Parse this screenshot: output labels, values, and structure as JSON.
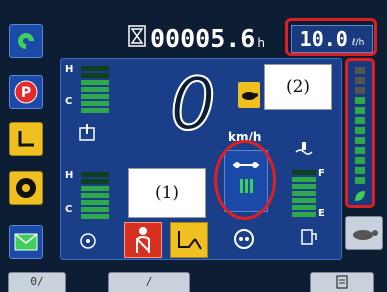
{
  "header": {
    "hourmeter_value": "00005.6",
    "hourmeter_unit": "h",
    "fuel_rate_value": "10.0",
    "fuel_rate_unit": "ℓ/h"
  },
  "speed": {
    "value": "0",
    "unit": "km/h"
  },
  "callouts": {
    "callout_1": "(1)",
    "callout_2": "(2)"
  },
  "gauges": {
    "temp_gauge_1": {
      "high_label": "H",
      "low_label": "C"
    },
    "temp_gauge_2": {
      "high_label": "H",
      "low_label": "C"
    },
    "fuel_gauge": {
      "full_label": "F",
      "empty_label": "E"
    }
  },
  "bottom_bar": {
    "tab_1": "0/",
    "tab_2": "/",
    "tab_3": ""
  },
  "colors": {
    "panel_blue": "#1b3f87",
    "accent_red_ring": "#e02020",
    "gauge_green": "#2ea84a",
    "warning_yellow": "#f0c020",
    "alert_red": "#d83020"
  },
  "icons": [
    "eco-mode-icon",
    "parking-brake-icon",
    "work-mode-icon",
    "steering-icon",
    "mail-icon",
    "hourglass-icon",
    "turtle-icon",
    "engine-temp-icon",
    "oil-temp-icon",
    "coolant-level-icon",
    "travel-mode-icon",
    "seat-belt-icon",
    "bucket-icon",
    "transmission-icon",
    "fuel-filter-icon",
    "menu-icon"
  ]
}
